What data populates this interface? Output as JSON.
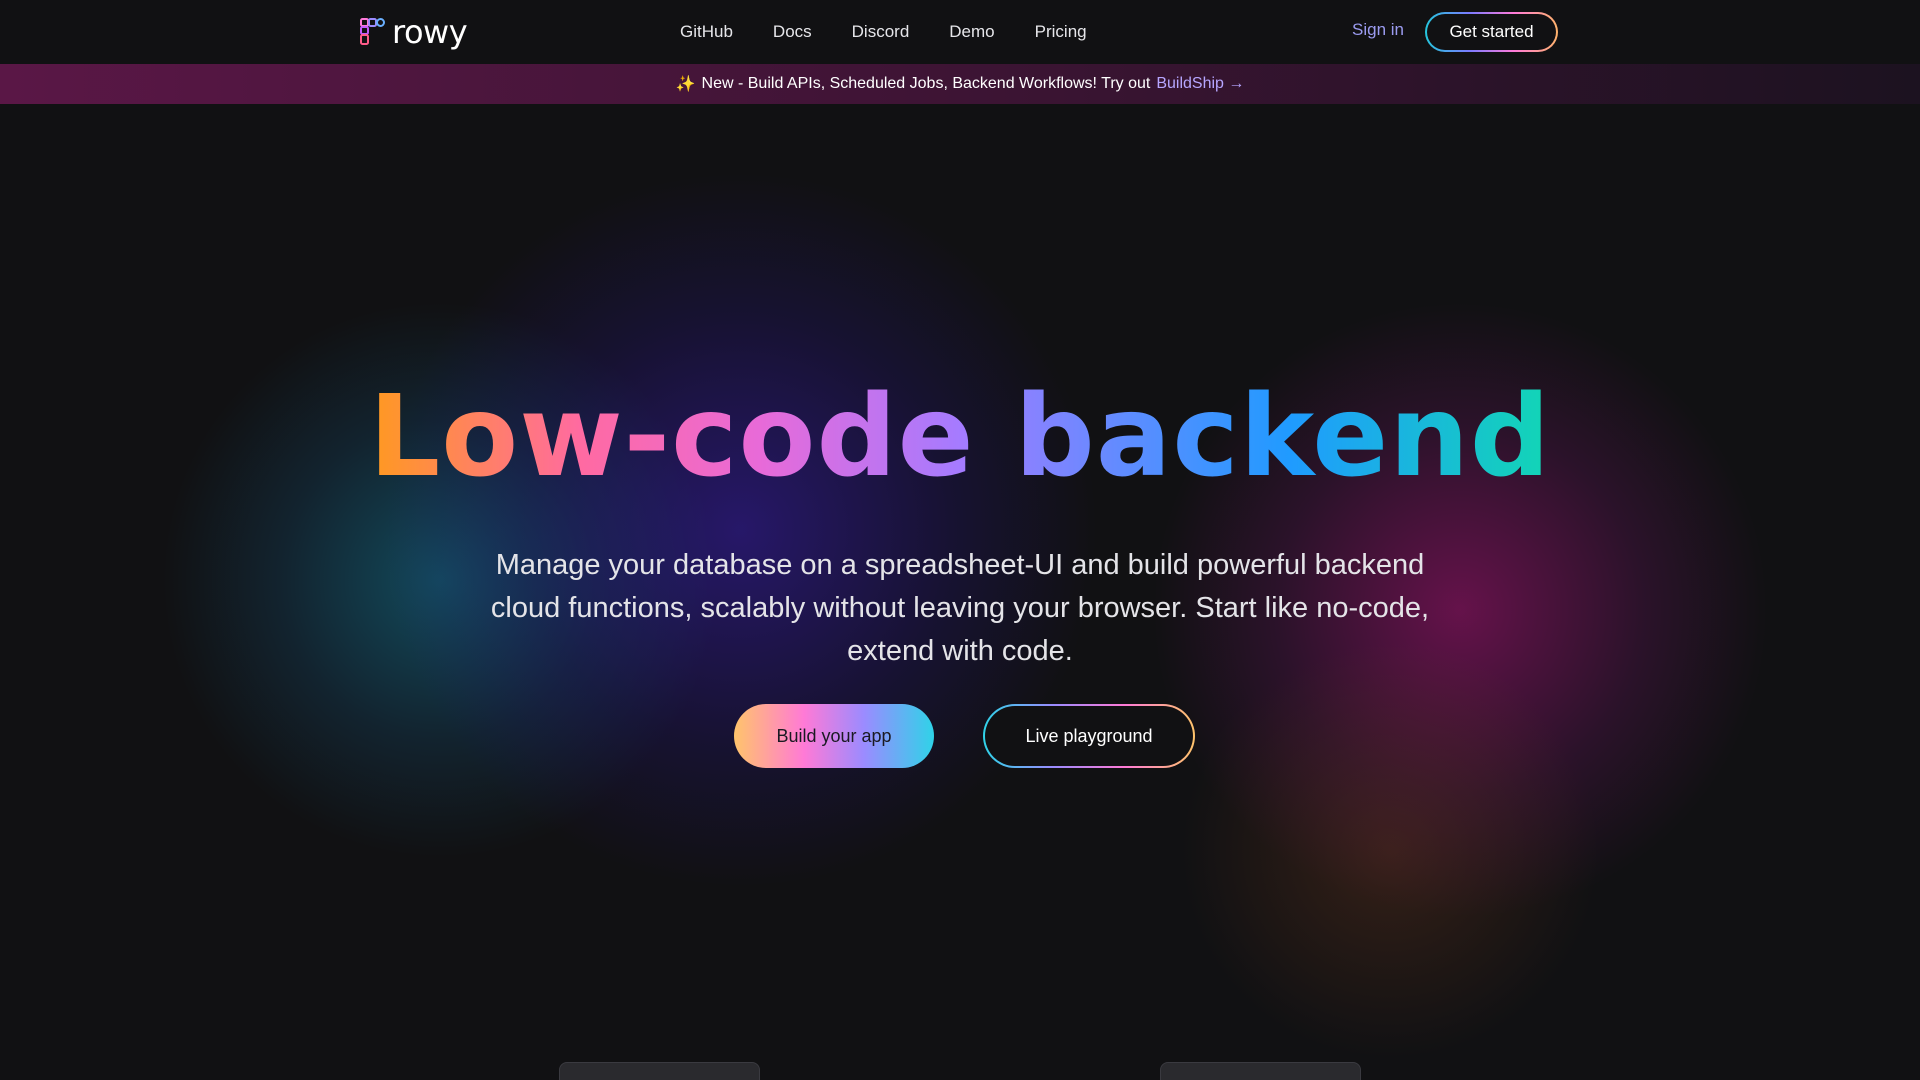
{
  "brand": {
    "name": "rowy",
    "logo_icon": "rowy-logo-icon"
  },
  "nav": {
    "links": [
      "GitHub",
      "Docs",
      "Discord",
      "Demo",
      "Pricing"
    ],
    "sign_in": "Sign in",
    "get_started": "Get started"
  },
  "banner": {
    "icon": "sparkle-icon",
    "text": "New - Build APIs, Scheduled Jobs, Backend Workflows! Try out",
    "link": "BuildShip →"
  },
  "hero": {
    "title": "Low-code backend",
    "subtitle": "Manage your database on a spreadsheet-UI and build powerful backend cloud functions, scalably without leaving your browser. Start like no-code, extend with code.",
    "primary_button": "Build your app",
    "secondary_button": "Live playground"
  },
  "colors": {
    "background": "#111113",
    "accent_link": "#9b9bf0",
    "banner_gradient_start": "#5a1746",
    "title_gradient": [
      "#ff9a1f",
      "#ff6aa2",
      "#a57bff",
      "#1f9bff",
      "#12d6b5"
    ]
  }
}
